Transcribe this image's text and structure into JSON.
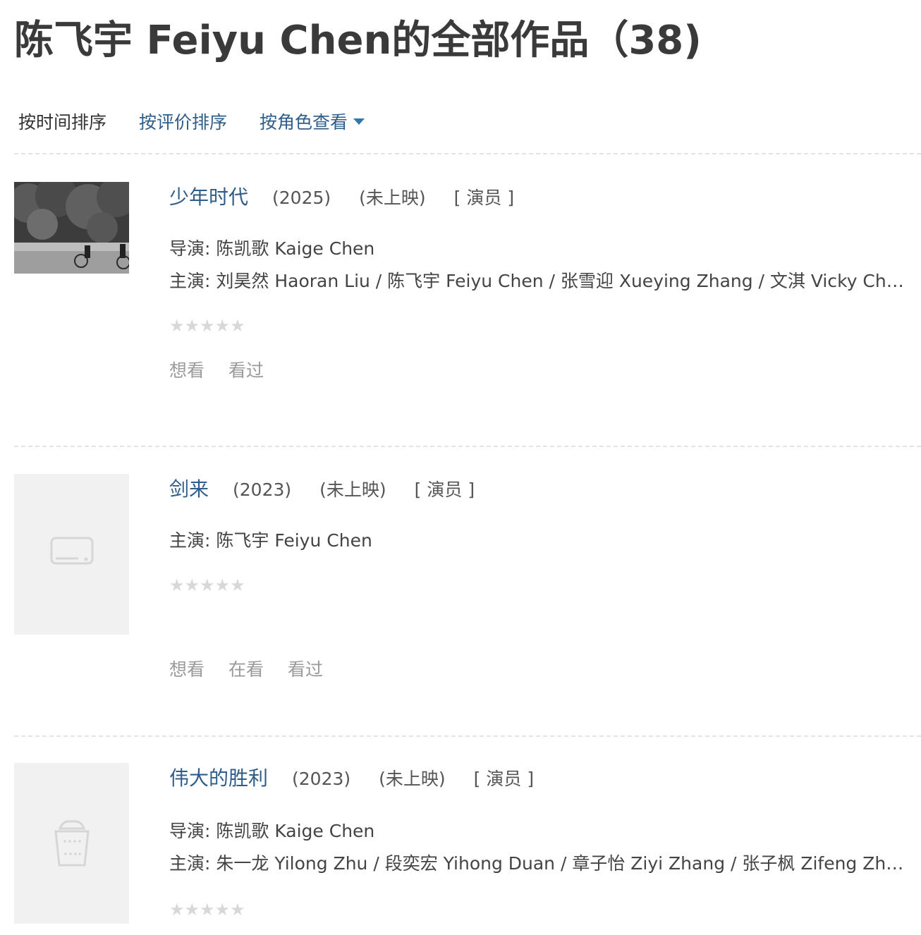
{
  "page": {
    "title": "陈飞宇 Feiyu Chen的全部作品（38)"
  },
  "sort": {
    "by_time": "按时间排序",
    "by_rating": "按评价排序",
    "by_role": "按角色查看"
  },
  "works": [
    {
      "title": "少年时代",
      "year": "(2025)",
      "status": "(未上映)",
      "role": "[ 演员 ]",
      "director_label": "导演:",
      "director": "陈凯歌 Kaige Chen",
      "cast_label": "主演:",
      "cast": "刘昊然 Haoran Liu / 陈飞宇 Feiyu Chen / 张雪迎 Xueying Zhang / 文淇 Vicky Chen",
      "stars": "★★★★★",
      "actions": [
        "想看",
        "看过"
      ]
    },
    {
      "title": "剑来",
      "year": "(2023)",
      "status": "(未上映)",
      "role": "[ 演员 ]",
      "cast_label": "主演:",
      "cast": "陈飞宇 Feiyu Chen",
      "stars": "★★★★★",
      "actions": [
        "想看",
        "在看",
        "看过"
      ]
    },
    {
      "title": "伟大的胜利",
      "year": "(2023)",
      "status": "(未上映)",
      "role": "[ 演员 ]",
      "director_label": "导演:",
      "director": "陈凯歌 Kaige Chen",
      "cast_label": "主演:",
      "cast": "朱一龙 Yilong Zhu / 段奕宏 Yihong Duan / 章子怡 Ziyi Zhang / 张子枫 Zifeng Zhang",
      "stars": "★★★★★"
    }
  ]
}
